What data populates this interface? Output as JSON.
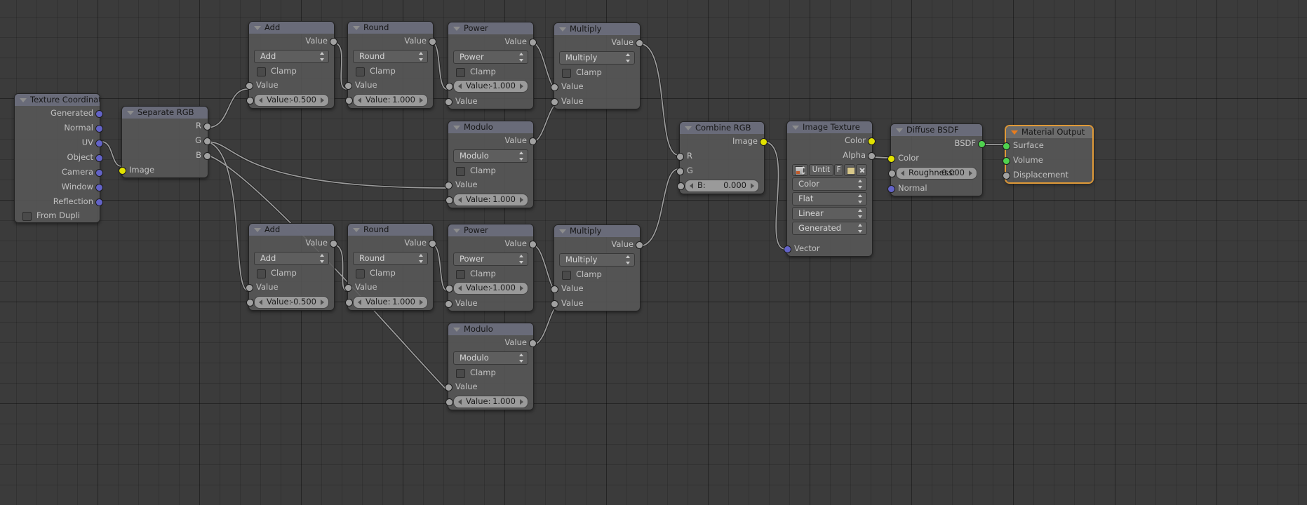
{
  "app": {
    "editor": "blender-node-editor",
    "colors": {
      "background": "#3b3b3b",
      "node_body": "#585858",
      "header_converter": "#6a6d7c",
      "socket_vector": "#6363c7",
      "socket_color": "#e2e200",
      "socket_value": "#a1a1a1",
      "socket_shader": "#4fd24f",
      "selected_outline": "#e09a38"
    }
  },
  "nodes": [
    {
      "id": "texture-coordinate",
      "title": "Texture Coordinate",
      "outputs": [
        "Generated",
        "Normal",
        "UV",
        "Object",
        "Camera",
        "Window",
        "Reflection"
      ],
      "checkbox": "From Dupli"
    },
    {
      "id": "separate-rgb",
      "title": "Separate RGB",
      "outputs": [
        "R",
        "G",
        "B"
      ],
      "inputs": [
        "Image"
      ]
    },
    {
      "id": "add-top",
      "title": "Add",
      "output": "Value",
      "operation": "Add",
      "clamp": "Clamp",
      "input_label": "Value",
      "value_label": "Value:",
      "value": "-0.500"
    },
    {
      "id": "round-top",
      "title": "Round",
      "output": "Value",
      "operation": "Round",
      "clamp": "Clamp",
      "input_label": "Value",
      "value_label": "Value:",
      "value": "1.000"
    },
    {
      "id": "power-top",
      "title": "Power",
      "output": "Value",
      "operation": "Power",
      "clamp": "Clamp",
      "value_label": "Value:",
      "value": "-1.000",
      "input_label": "Value"
    },
    {
      "id": "multiply-top",
      "title": "Multiply",
      "output": "Value",
      "operation": "Multiply",
      "clamp": "Clamp",
      "input_a": "Value",
      "input_b": "Value"
    },
    {
      "id": "modulo-top",
      "title": "Modulo",
      "output": "Value",
      "operation": "Modulo",
      "clamp": "Clamp",
      "input_label": "Value",
      "value_label": "Value:",
      "value": "1.000"
    },
    {
      "id": "add-bottom",
      "title": "Add",
      "output": "Value",
      "operation": "Add",
      "clamp": "Clamp",
      "input_label": "Value",
      "value_label": "Value:",
      "value": "-0.500"
    },
    {
      "id": "round-bottom",
      "title": "Round",
      "output": "Value",
      "operation": "Round",
      "clamp": "Clamp",
      "input_label": "Value",
      "value_label": "Value:",
      "value": "1.000"
    },
    {
      "id": "power-bottom",
      "title": "Power",
      "output": "Value",
      "operation": "Power",
      "clamp": "Clamp",
      "value_label": "Value:",
      "value": "-1.000",
      "input_label": "Value"
    },
    {
      "id": "multiply-bottom",
      "title": "Multiply",
      "output": "Value",
      "operation": "Multiply",
      "clamp": "Clamp",
      "input_a": "Value",
      "input_b": "Value"
    },
    {
      "id": "modulo-bottom",
      "title": "Modulo",
      "output": "Value",
      "operation": "Modulo",
      "clamp": "Clamp",
      "input_label": "Value",
      "value_label": "Value:",
      "value": "1.000"
    },
    {
      "id": "combine-rgb",
      "title": "Combine RGB",
      "output": "Image",
      "inputs": [
        "R",
        "G"
      ],
      "value_label": "B:",
      "value": "0.000"
    },
    {
      "id": "image-texture",
      "title": "Image Texture",
      "outputs": [
        "Color",
        "Alpha"
      ],
      "image_name": "Untit",
      "fake_user": "F",
      "projection": "Color",
      "interpolation": "Flat",
      "extension": "Linear",
      "coordinates": "Generated",
      "input": "Vector"
    },
    {
      "id": "diffuse-bsdf",
      "title": "Diffuse BSDF",
      "output": "BSDF",
      "inputs": [
        "Color",
        "Normal"
      ],
      "roughness_label": "Roughness:",
      "roughness_value": "0.000"
    },
    {
      "id": "material-output",
      "title": "Material Output",
      "inputs": [
        "Surface",
        "Volume",
        "Displacement"
      ],
      "selected": true
    }
  ]
}
